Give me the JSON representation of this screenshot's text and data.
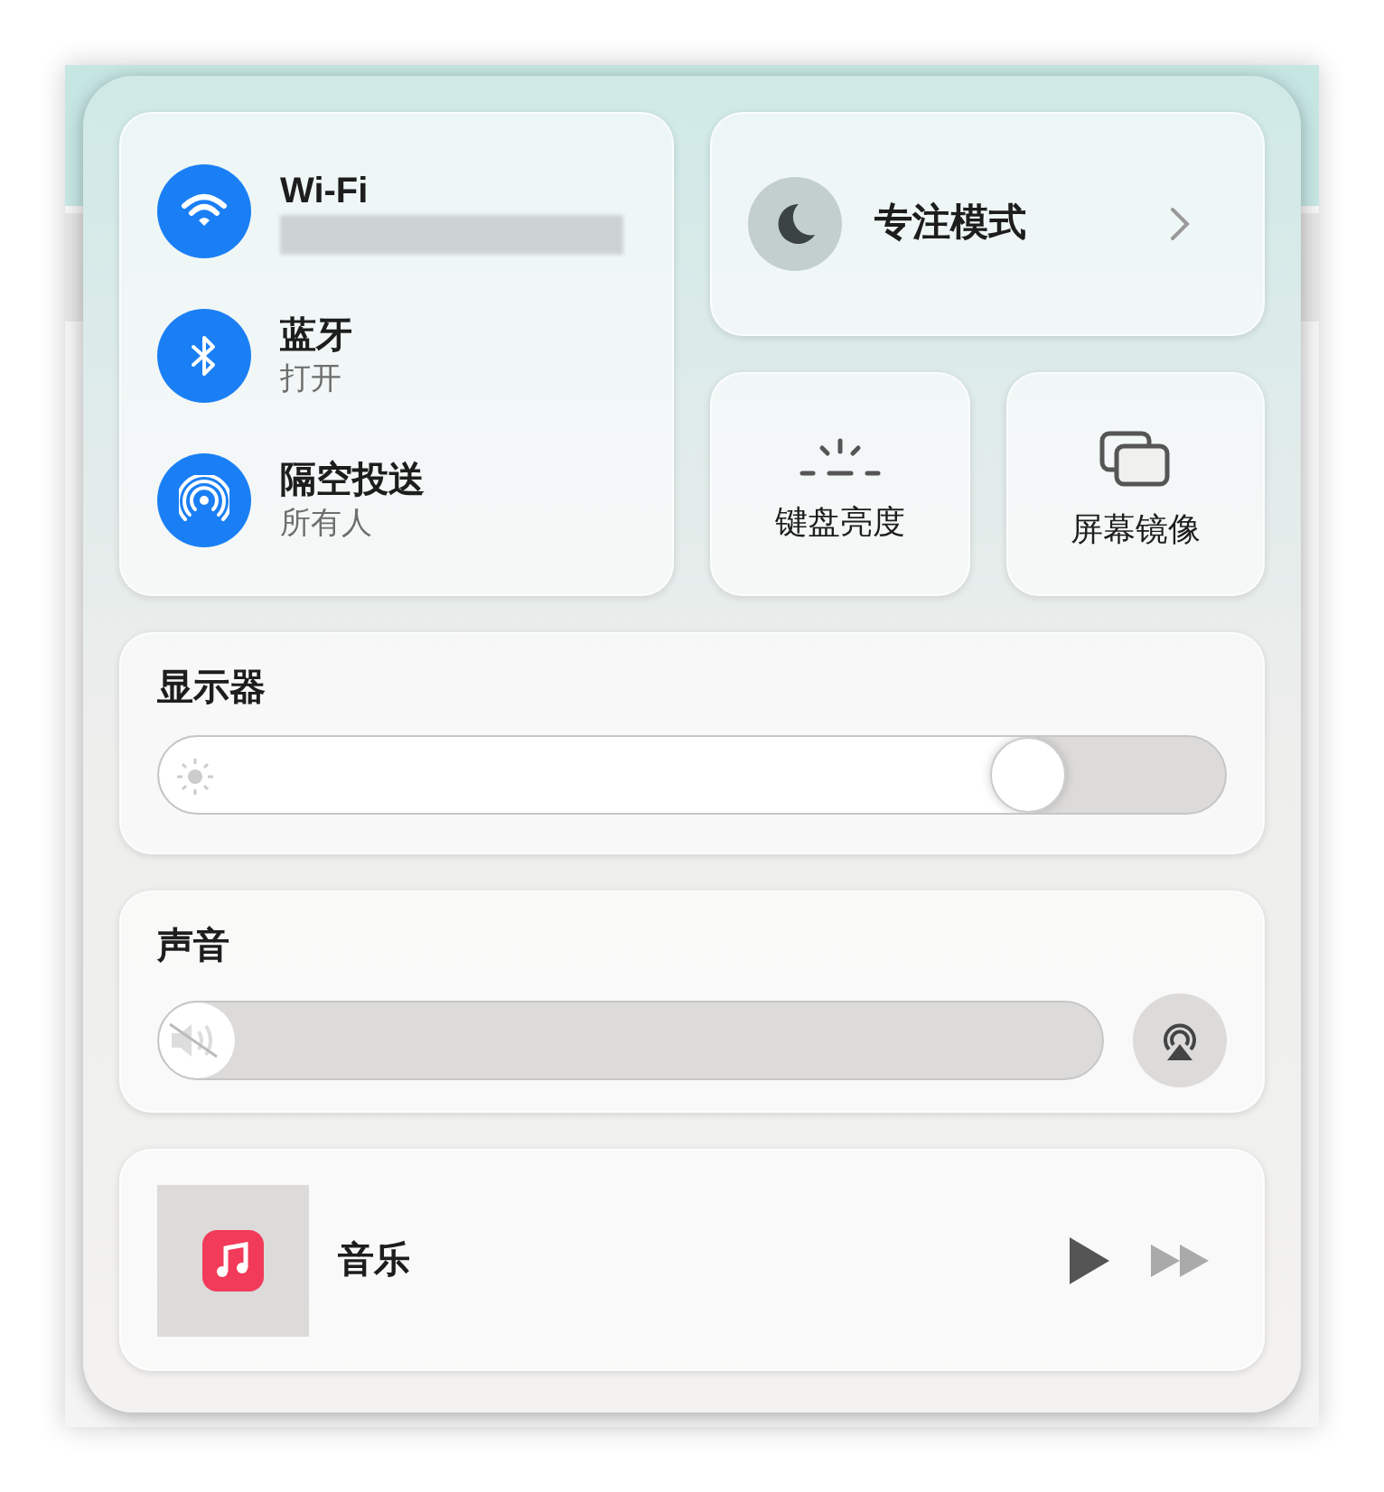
{
  "connectivity": [
    {
      "kind": "wifi",
      "label": "Wi-Fi",
      "on": true,
      "redacted": true
    },
    {
      "kind": "bluetooth",
      "label": "蓝牙",
      "status": "打开",
      "on": true
    },
    {
      "kind": "airdrop",
      "label": "隔空投送",
      "status": "所有人",
      "on": true
    }
  ],
  "focus": {
    "label": "专注模式",
    "on": false
  },
  "tiles": [
    {
      "kind": "keyboard",
      "label": "键盘亮度"
    },
    {
      "kind": "mirror",
      "label": "屏幕镜像"
    }
  ],
  "display": {
    "title": "显示器",
    "level": 0.85
  },
  "sound": {
    "title": "声音",
    "level": 0.07,
    "muted": true
  },
  "now_playing": {
    "app": "音乐"
  }
}
